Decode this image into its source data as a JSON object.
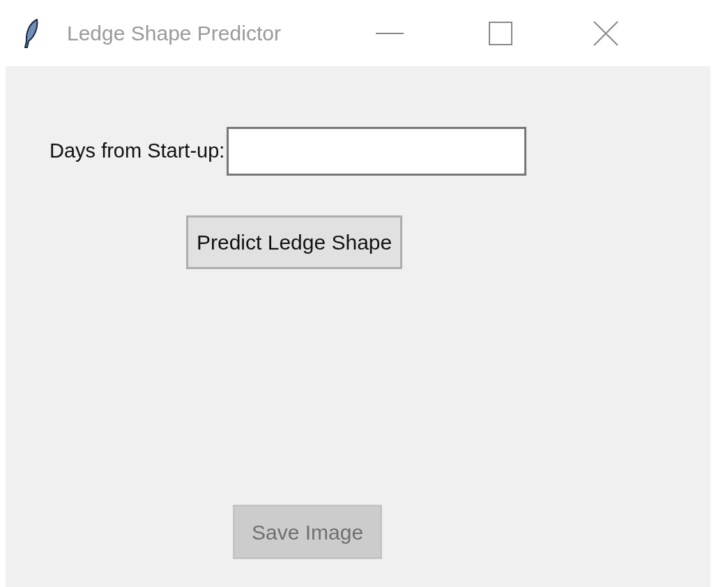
{
  "window": {
    "title": "Ledge Shape Predictor"
  },
  "days_field": {
    "label": "Days from Start-up:"
  },
  "buttons": [
    {
      "label": "Predict Ledge Shape",
      "disabled": false
    },
    {
      "label": "Save Image",
      "disabled": true
    }
  ]
}
